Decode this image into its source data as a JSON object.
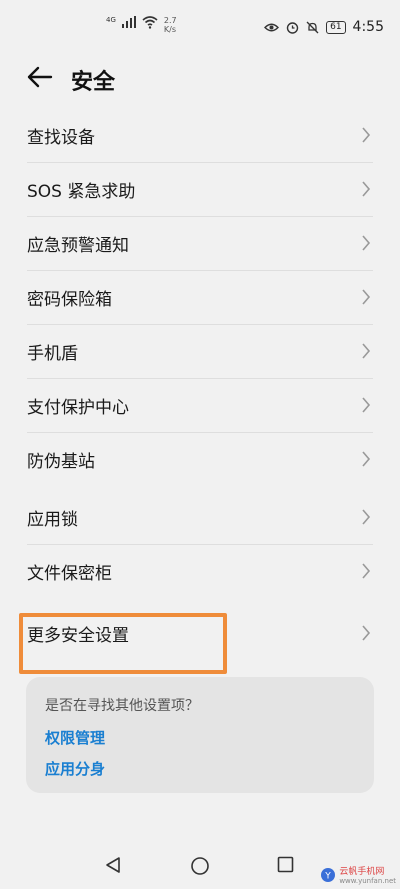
{
  "status_bar": {
    "signal": "4G",
    "speed_value": "2.7",
    "speed_unit": "K/s",
    "battery": "61",
    "time": "4:55"
  },
  "header": {
    "title": "安全"
  },
  "group1": [
    {
      "label": "查找设备"
    },
    {
      "label": "SOS 紧急求助"
    },
    {
      "label": "应急预警通知"
    },
    {
      "label": "密码保险箱"
    },
    {
      "label": "手机盾"
    },
    {
      "label": "支付保护中心"
    },
    {
      "label": "防伪基站"
    }
  ],
  "group2": [
    {
      "label": "应用锁"
    },
    {
      "label": "文件保密柜"
    }
  ],
  "group3": [
    {
      "label": "更多安全设置"
    }
  ],
  "suggest": {
    "question": "是否在寻找其他设置项？",
    "links": [
      "权限管理",
      "应用分身"
    ]
  },
  "watermark": {
    "text": "云帆手机网",
    "url": "www.yunfan.net"
  },
  "colors": {
    "background": "#f1f1f1",
    "link": "#1a7fd1",
    "highlight": "#ef8c3a"
  },
  "icons": [
    "back-arrow-icon",
    "chevron-right-icon",
    "eye-icon",
    "alarm-icon",
    "mute-icon",
    "wifi-icon",
    "signal-icon",
    "triangle-back-icon",
    "circle-home-icon",
    "square-recents-icon"
  ]
}
